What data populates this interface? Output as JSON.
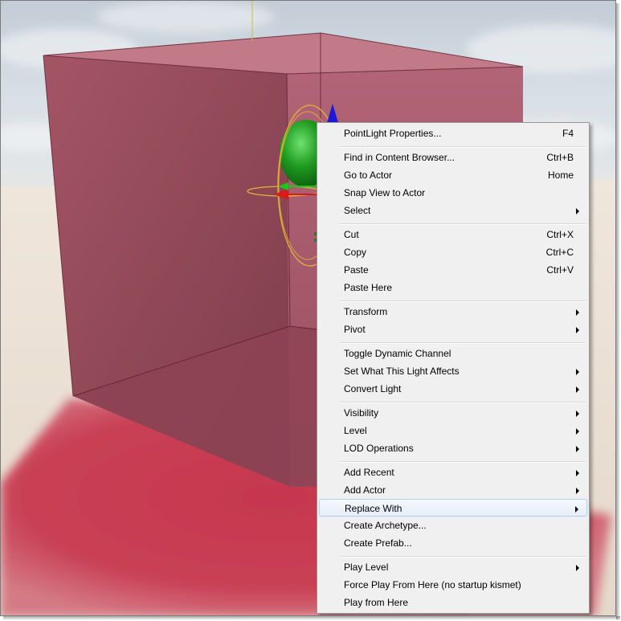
{
  "colors": {
    "menu_background": "#f0f0f0",
    "menu_border": "#979797",
    "highlight_border": "#aecff7",
    "cube": "#9e4a5e",
    "floor": "#e9ddd2",
    "sky": "#c8d4df",
    "light_sphere": "#1f9a1f",
    "gizmo_ring": "#e0b43a"
  },
  "viewport": {
    "objects": [
      "translucent-red-cube",
      "point-light-sprite",
      "translate-gizmo",
      "rotation-ring"
    ]
  },
  "menu": {
    "highlighted_index": 19,
    "items": [
      {
        "label": "PointLight Properties...",
        "shortcut": "F4",
        "submenu": false
      },
      {
        "label": "Find in Content Browser...",
        "shortcut": "Ctrl+B",
        "submenu": false
      },
      {
        "label": "Go to Actor",
        "shortcut": "Home",
        "submenu": false
      },
      {
        "label": "Snap View to Actor",
        "shortcut": "",
        "submenu": false
      },
      {
        "label": "Select",
        "shortcut": "",
        "submenu": true
      },
      {
        "label": "Cut",
        "shortcut": "Ctrl+X",
        "submenu": false
      },
      {
        "label": "Copy",
        "shortcut": "Ctrl+C",
        "submenu": false
      },
      {
        "label": "Paste",
        "shortcut": "Ctrl+V",
        "submenu": false
      },
      {
        "label": "Paste Here",
        "shortcut": "",
        "submenu": false
      },
      {
        "label": "Transform",
        "shortcut": "",
        "submenu": true
      },
      {
        "label": "Pivot",
        "shortcut": "",
        "submenu": true
      },
      {
        "label": "Toggle Dynamic Channel",
        "shortcut": "",
        "submenu": false
      },
      {
        "label": "Set What This Light Affects",
        "shortcut": "",
        "submenu": true
      },
      {
        "label": "Convert Light",
        "shortcut": "",
        "submenu": true
      },
      {
        "label": "Visibility",
        "shortcut": "",
        "submenu": true
      },
      {
        "label": "Level",
        "shortcut": "",
        "submenu": true
      },
      {
        "label": "LOD Operations",
        "shortcut": "",
        "submenu": true
      },
      {
        "label": "Add Recent",
        "shortcut": "",
        "submenu": true
      },
      {
        "label": "Add Actor",
        "shortcut": "",
        "submenu": true
      },
      {
        "label": "Replace With",
        "shortcut": "",
        "submenu": true
      },
      {
        "label": "Create Archetype...",
        "shortcut": "",
        "submenu": false
      },
      {
        "label": "Create Prefab...",
        "shortcut": "",
        "submenu": false
      },
      {
        "label": "Play Level",
        "shortcut": "",
        "submenu": true
      },
      {
        "label": "Force Play From Here (no startup kismet)",
        "shortcut": "",
        "submenu": false
      },
      {
        "label": "Play from Here",
        "shortcut": "",
        "submenu": false
      }
    ]
  }
}
